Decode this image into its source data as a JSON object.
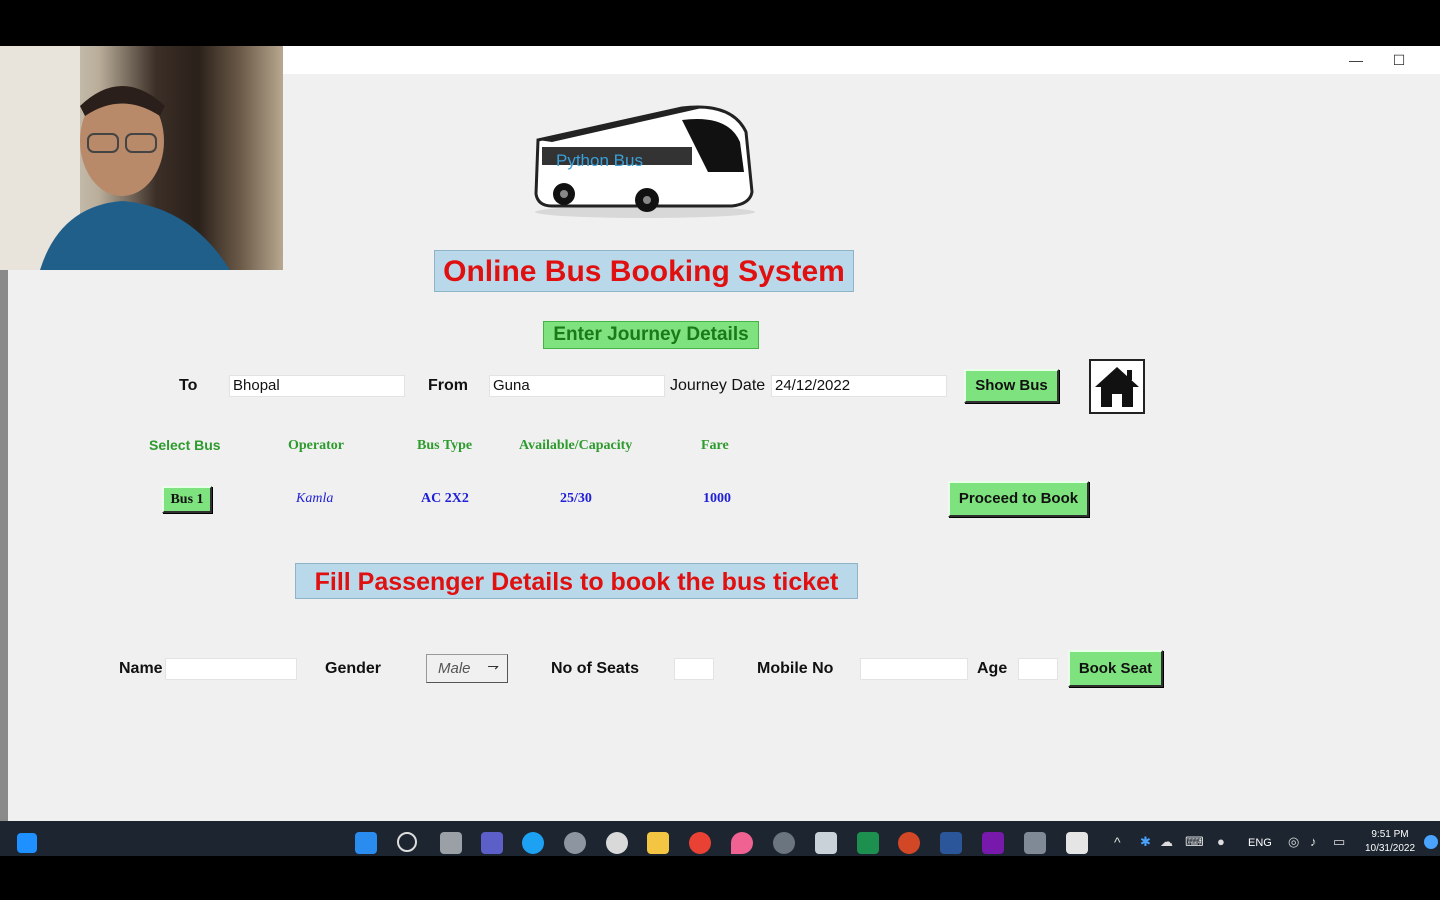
{
  "window": {
    "minimize_glyph": "—",
    "maximize_glyph": "☐"
  },
  "logo_text": "Python Bus",
  "title": "Online Bus Booking System",
  "journey_heading": "Enter Journey Details",
  "journey": {
    "to_label": "To",
    "to_value": "Bhopal",
    "from_label": "From",
    "from_value": "Guna",
    "date_label": "Journey Date",
    "date_value": "24/12/2022",
    "show_bus_label": "Show Bus",
    "home_icon": "house-icon"
  },
  "bus_table": {
    "headers": [
      "Select Bus",
      "Operator",
      "Bus Type",
      "Available/Capacity",
      "Fare"
    ],
    "row": {
      "select": "Bus 1",
      "operator": "Kamla",
      "bus_type": "AC 2X2",
      "availability": "25/30",
      "fare": "1000"
    },
    "proceed_label": "Proceed to Book"
  },
  "passenger_heading": "Fill Passenger Details to book the bus ticket",
  "passenger": {
    "name_label": "Name",
    "name_value": "",
    "gender_label": "Gender",
    "gender_value": "Male",
    "seats_label": "No of Seats",
    "seats_value": "",
    "mobile_label": "Mobile No",
    "mobile_value": "",
    "age_label": "Age",
    "age_value": "",
    "book_label": "Book Seat"
  },
  "taskbar": {
    "language": "ENG",
    "time": "9:51 PM",
    "date": "10/31/2022"
  },
  "colors": {
    "title_red": "#e01010",
    "button_green": "#7ee37e",
    "header_green": "#2e9b2e",
    "value_blue": "#2020d8",
    "title_bg": "#b9d9ea"
  }
}
